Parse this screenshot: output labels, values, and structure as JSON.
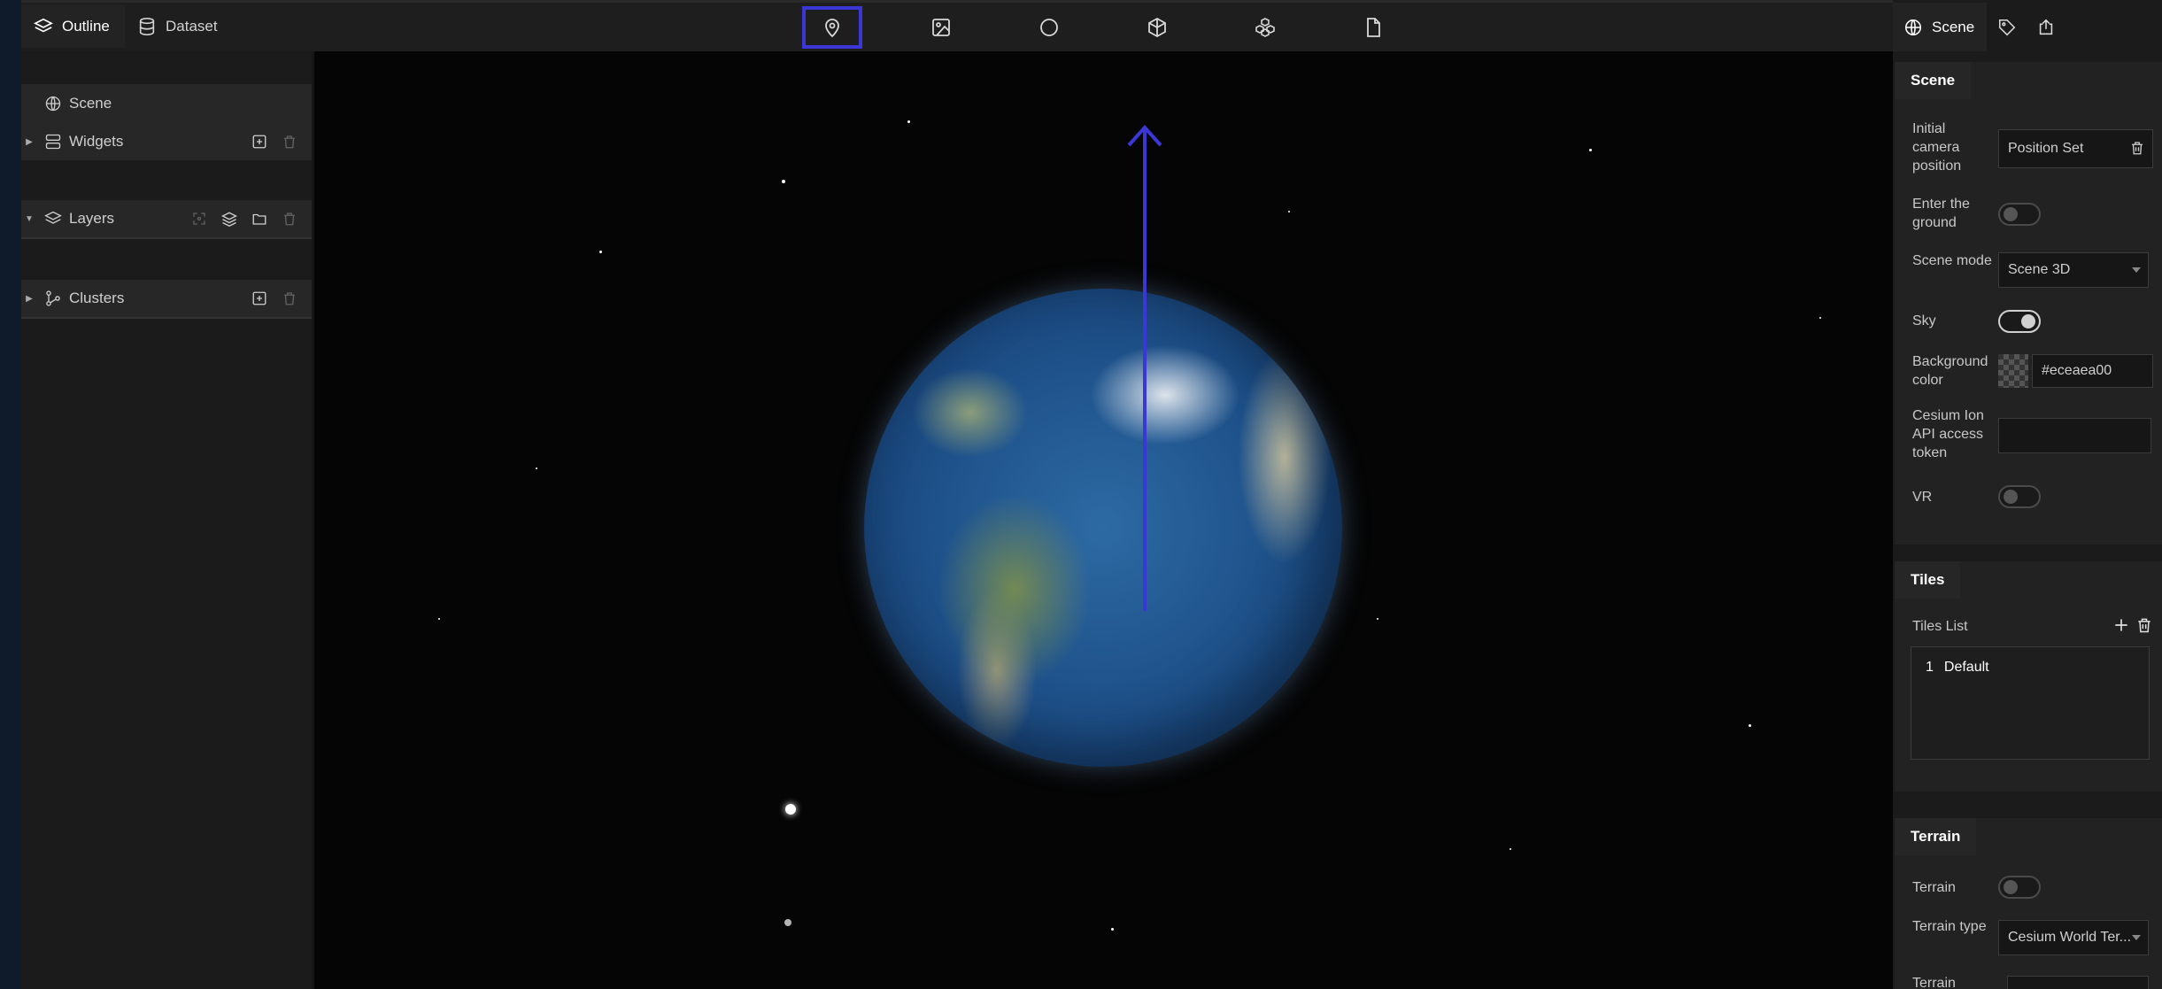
{
  "left_tabs": [
    {
      "label": "Outline",
      "icon": "layers-icon"
    },
    {
      "label": "Dataset",
      "icon": "database-icon"
    }
  ],
  "outline": {
    "scene": {
      "label": "Scene",
      "icon": "globe-icon"
    },
    "widgets": {
      "label": "Widgets",
      "icon": "widgets-icon"
    },
    "layers": {
      "label": "Layers",
      "icon": "layers-icon"
    },
    "clusters": {
      "label": "Clusters",
      "icon": "cluster-icon"
    }
  },
  "toolbar": {
    "tools": [
      "map-pin-icon",
      "image-icon",
      "circle-icon",
      "polygon-3d-icon",
      "model-icon",
      "file-icon"
    ],
    "highlighted_tool": "map-pin-icon",
    "highlight_color": "#3b36d6"
  },
  "right_tabs": [
    {
      "label": "Scene",
      "icon": "globe-icon"
    },
    {
      "label": "",
      "icon": "tag-icon"
    },
    {
      "label": "",
      "icon": "export-icon"
    }
  ],
  "scene_group": {
    "title": "Scene",
    "initial_camera_label": "Initial camera position",
    "initial_camera_value": "Position Set",
    "enter_ground_label": "Enter the ground",
    "enter_ground_on": false,
    "scene_mode_label": "Scene mode",
    "scene_mode_value": "Scene 3D",
    "sky_label": "Sky",
    "sky_on": true,
    "background_color_label": "Background color",
    "background_color_value": "#eceaea00",
    "cesium_token_label": "Cesium Ion API access token",
    "cesium_token_value": "",
    "vr_label": "VR",
    "vr_on": false
  },
  "tiles_group": {
    "title": "Tiles",
    "list_label": "Tiles List",
    "items": [
      {
        "index": "1",
        "name": "Default"
      }
    ]
  },
  "terrain_group": {
    "title": "Terrain",
    "terrain_label": "Terrain",
    "terrain_on": false,
    "terrain_type_label": "Terrain type",
    "terrain_type_value": "Cesium World Ter...",
    "terrain_more_label": "Terrain"
  }
}
